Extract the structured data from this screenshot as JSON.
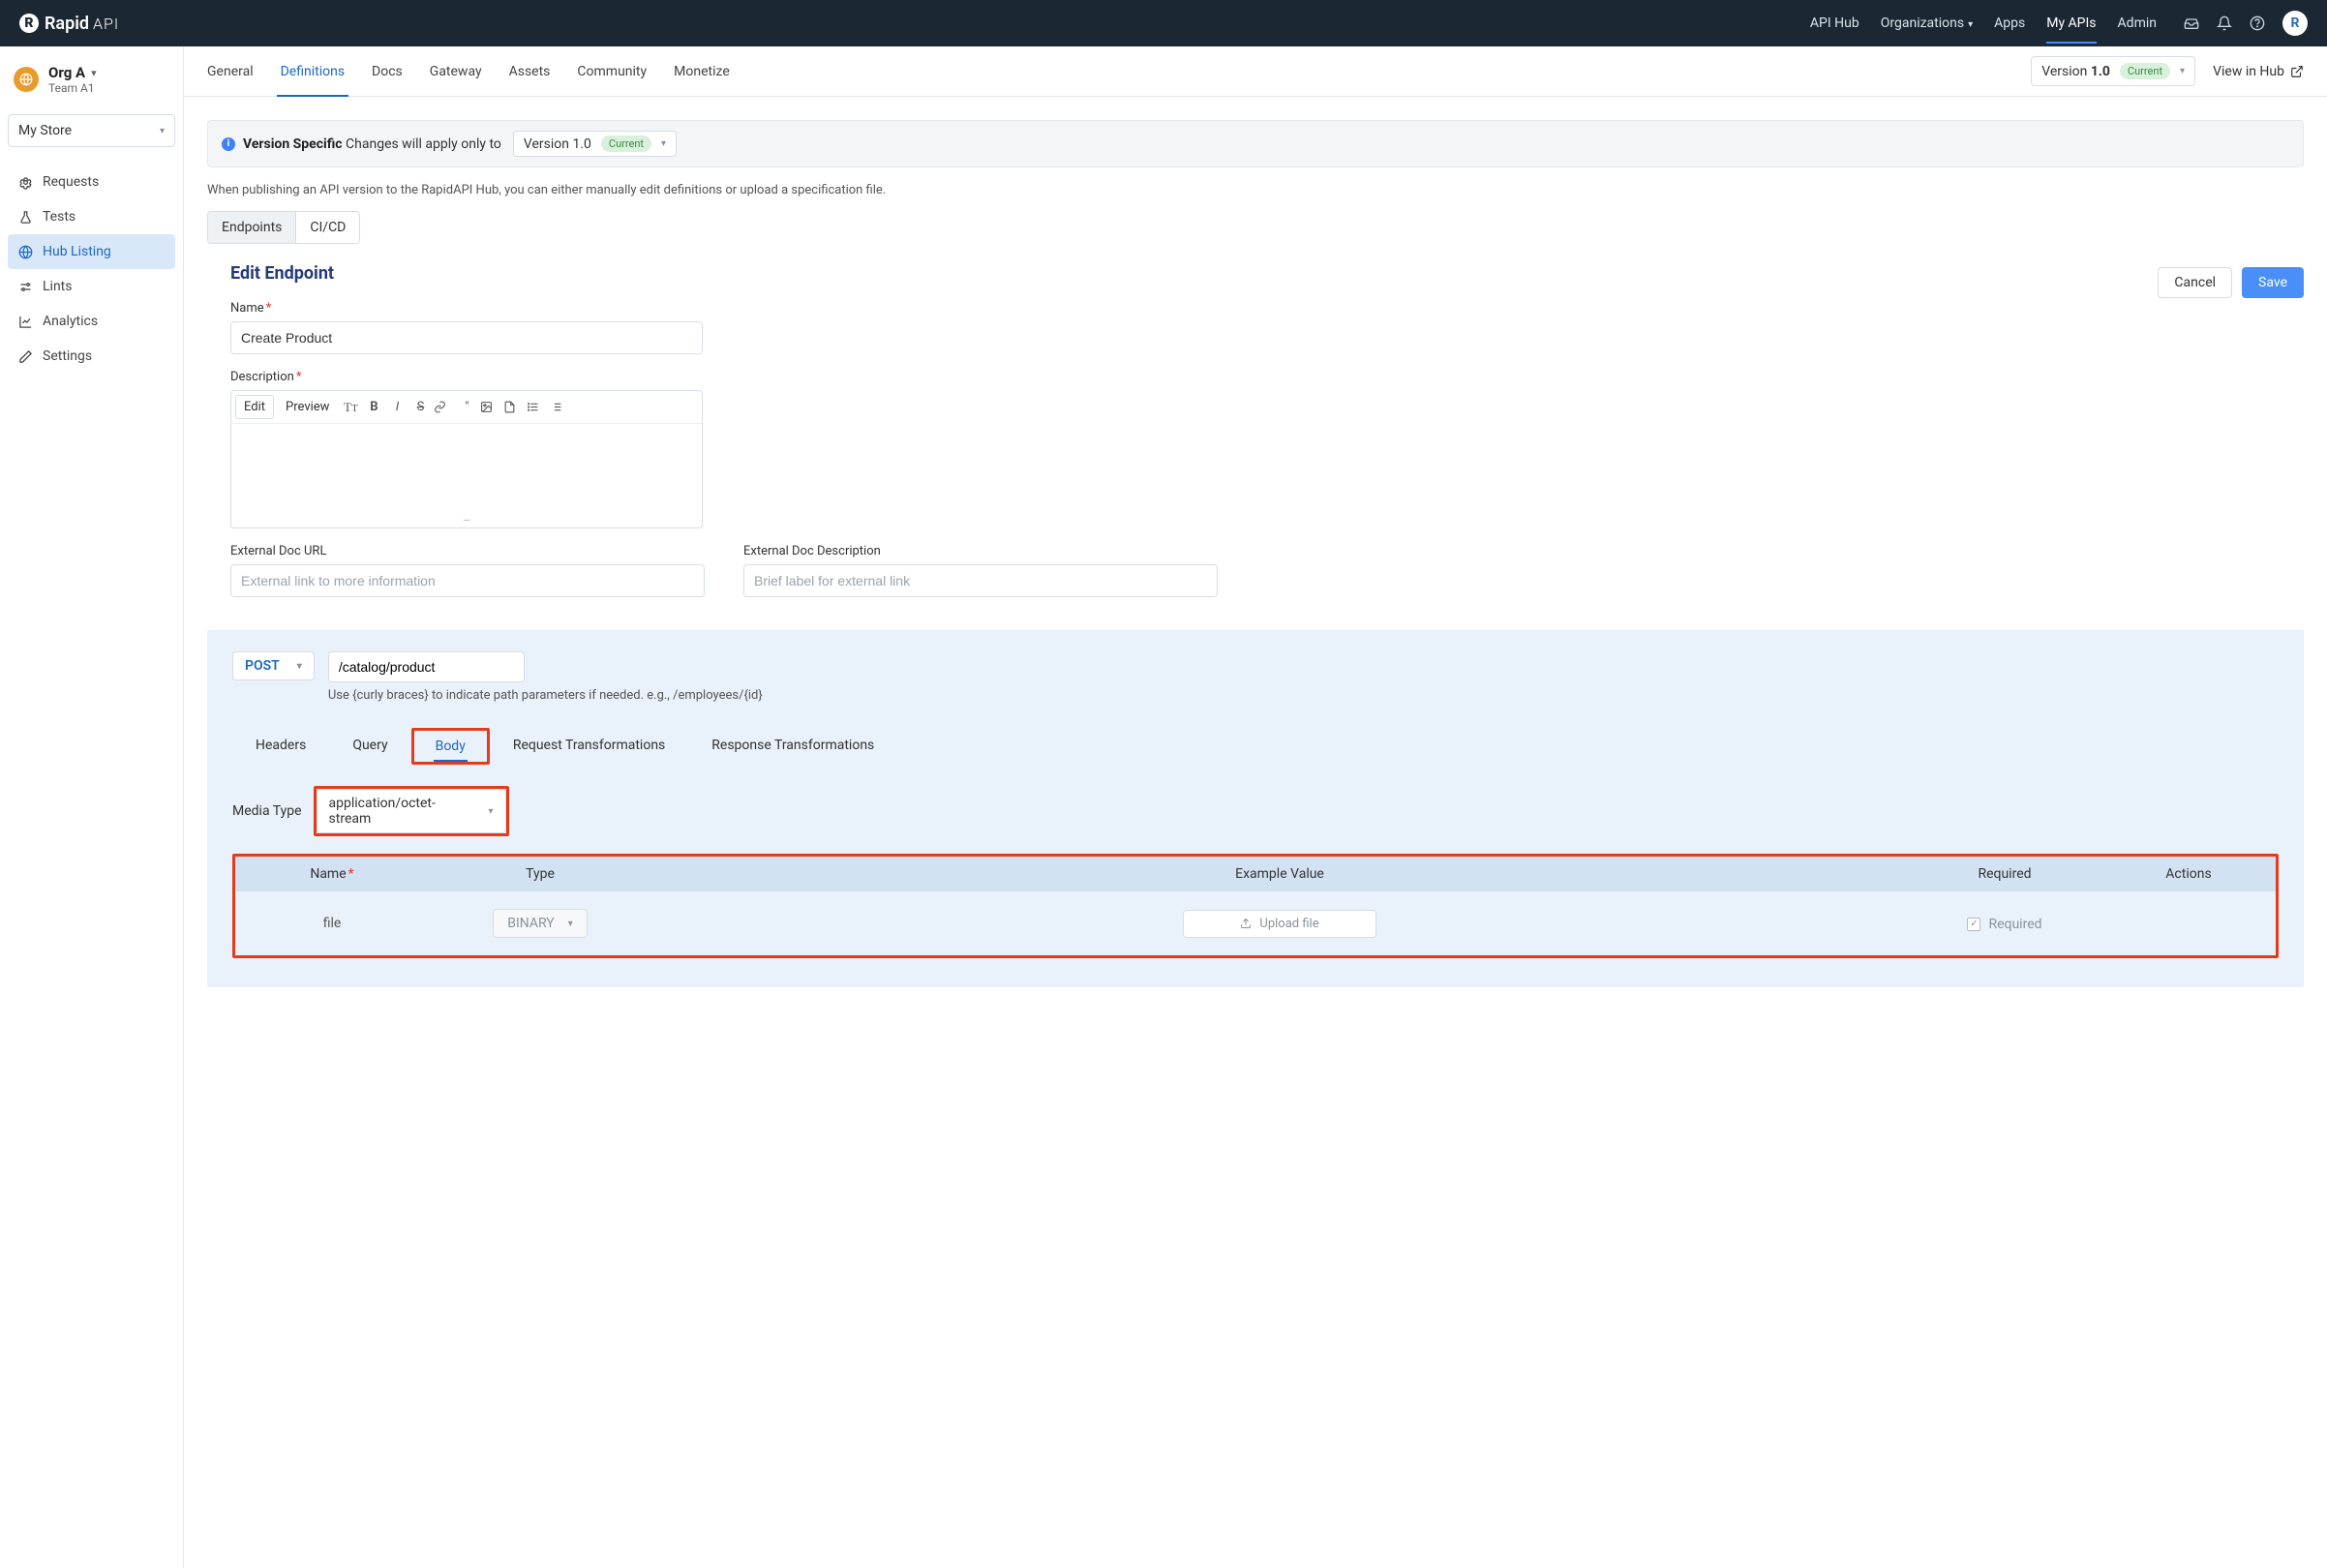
{
  "top": {
    "brand_main": "Rapid",
    "brand_sub": "API",
    "nav": {
      "api_hub": "API Hub",
      "organizations": "Organizations",
      "apps": "Apps",
      "my_apis": "My APIs",
      "admin": "Admin"
    },
    "avatar_letter": "R"
  },
  "sidebar": {
    "org_name": "Org A",
    "team": "Team A1",
    "store": "My Store",
    "items": [
      {
        "label": "Requests"
      },
      {
        "label": "Tests"
      },
      {
        "label": "Hub Listing"
      },
      {
        "label": "Lints"
      },
      {
        "label": "Analytics"
      },
      {
        "label": "Settings"
      }
    ]
  },
  "subnav": {
    "tabs": {
      "general": "General",
      "definitions": "Definitions",
      "docs": "Docs",
      "gateway": "Gateway",
      "assets": "Assets",
      "community": "Community",
      "monetize": "Monetize"
    },
    "version_label": "Version",
    "version_value": "1.0",
    "current_badge": "Current",
    "view_in_hub": "View in Hub"
  },
  "banner": {
    "strong": "Version Specific",
    "text": "Changes will apply only to",
    "inline_version": "Version 1.0",
    "inline_badge": "Current"
  },
  "hint": "When publishing an API version to the RapidAPI Hub, you can either manually edit definitions or upload a specification file.",
  "pilltabs": {
    "endpoints": "Endpoints",
    "cicd": "CI/CD"
  },
  "form": {
    "title": "Edit Endpoint",
    "cancel": "Cancel",
    "save": "Save",
    "name_label": "Name",
    "name_value": "Create Product",
    "desc_label": "Description",
    "rte": {
      "edit": "Edit",
      "preview": "Preview"
    },
    "ext_url_label": "External Doc URL",
    "ext_url_placeholder": "External link to more information",
    "ext_desc_label": "External Doc Description",
    "ext_desc_placeholder": "Brief label for external link"
  },
  "endpoint": {
    "method": "POST",
    "path": "/catalog/product",
    "path_hint": "Use {curly braces} to indicate path parameters if needed. e.g., /employees/{id}",
    "tabs": {
      "headers": "Headers",
      "query": "Query",
      "body": "Body",
      "req_tf": "Request Transformations",
      "res_tf": "Response Transformations"
    },
    "media_type_label": "Media Type",
    "media_type_value": "application/octet-stream",
    "columns": {
      "name": "Name",
      "type": "Type",
      "example": "Example Value",
      "required": "Required",
      "actions": "Actions"
    },
    "row": {
      "name": "file",
      "type": "BINARY",
      "upload": "Upload file",
      "required": "Required"
    }
  }
}
